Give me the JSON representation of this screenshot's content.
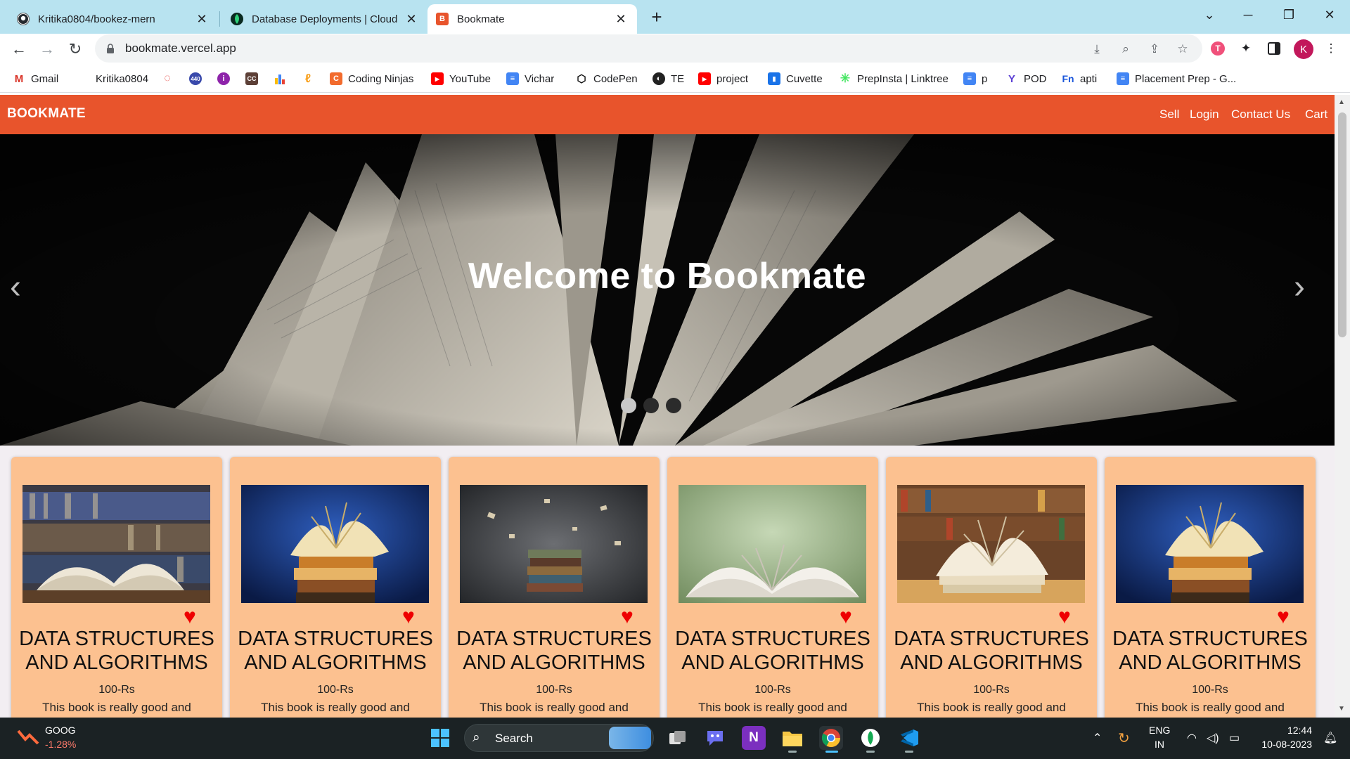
{
  "browser": {
    "tabs": [
      {
        "title": "Kritika0804/bookez-mern",
        "icon": "github-icon"
      },
      {
        "title": "Database Deployments | Cloud: M",
        "icon": "mongodb-leaf-icon"
      },
      {
        "title": "Bookmate",
        "icon": "bookmate-b-icon"
      }
    ],
    "url": "bookmate.vercel.app",
    "avatar_letter": "K",
    "bookmarks": [
      {
        "label": "Gmail",
        "icon": "gmail-icon"
      },
      {
        "label": "Kritika0804",
        "icon": "github-icon"
      },
      {
        "label": "",
        "icon": "chat-icon"
      },
      {
        "label": "",
        "icon": "badge-440-icon"
      },
      {
        "label": "",
        "icon": "info-purple-icon"
      },
      {
        "label": "",
        "icon": "cc-icon"
      },
      {
        "label": "",
        "icon": "bar-chart-icon"
      },
      {
        "label": "",
        "icon": "leetcode-icon"
      },
      {
        "label": "Coding Ninjas",
        "icon": "coding-ninjas-icon"
      },
      {
        "label": "YouTube",
        "icon": "youtube-icon"
      },
      {
        "label": "Vichar",
        "icon": "docs-icon"
      },
      {
        "label": "CodePen",
        "icon": "codepen-icon"
      },
      {
        "label": "TE",
        "icon": "globe-icon"
      },
      {
        "label": "project",
        "icon": "youtube-icon"
      },
      {
        "label": "Cuvette",
        "icon": "cuvette-icon"
      },
      {
        "label": "PrepInsta | Linktree",
        "icon": "linktree-icon"
      },
      {
        "label": "p",
        "icon": "docs-icon"
      },
      {
        "label": "POD",
        "icon": "pod-icon"
      },
      {
        "label": "apti",
        "icon": "fn-icon"
      },
      {
        "label": "Placement Prep - G...",
        "icon": "docs-icon"
      }
    ]
  },
  "site": {
    "brand": "BOOKMATE",
    "nav": [
      "Sell",
      "Login",
      "Contact Us",
      "Cart"
    ],
    "hero_title": "Welcome to Bookmate",
    "carousel_prev": "‹",
    "carousel_next": "›",
    "cards": [
      {
        "title": "DATA STRUCTURES AND ALGORITHMS",
        "price": "100-Rs",
        "desc": "This book is really good and",
        "image": "books-library-shelf"
      },
      {
        "title": "DATA STRUCTURES AND ALGORITHMS",
        "price": "100-Rs",
        "desc": "This book is really good and",
        "image": "book-stack-blue"
      },
      {
        "title": "DATA STRUCTURES AND ALGORITHMS",
        "price": "100-Rs",
        "desc": "This book is really good and",
        "image": "book-stack-flying-pages"
      },
      {
        "title": "DATA STRUCTURES AND ALGORITHMS",
        "price": "100-Rs",
        "desc": "This book is really good and",
        "image": "open-book-green"
      },
      {
        "title": "DATA STRUCTURES AND ALGORITHMS",
        "price": "100-Rs",
        "desc": "This book is really good and",
        "image": "open-book-shelf"
      },
      {
        "title": "DATA STRUCTURES AND ALGORITHMS",
        "price": "100-Rs",
        "desc": "This book is really good and",
        "image": "book-stack-blue"
      }
    ]
  },
  "taskbar": {
    "stock_symbol": "GOOG",
    "stock_change": "-1.28%",
    "search_label": "Search",
    "lang_top": "ENG",
    "lang_bottom": "IN",
    "time": "12:44",
    "date": "10-08-2023"
  },
  "colors": {
    "navbar": "#e8542c",
    "card": "#fcc190",
    "tabstrip": "#b8e3f0",
    "heart": "#ee0000",
    "stock_down": "#ff7b6b"
  }
}
